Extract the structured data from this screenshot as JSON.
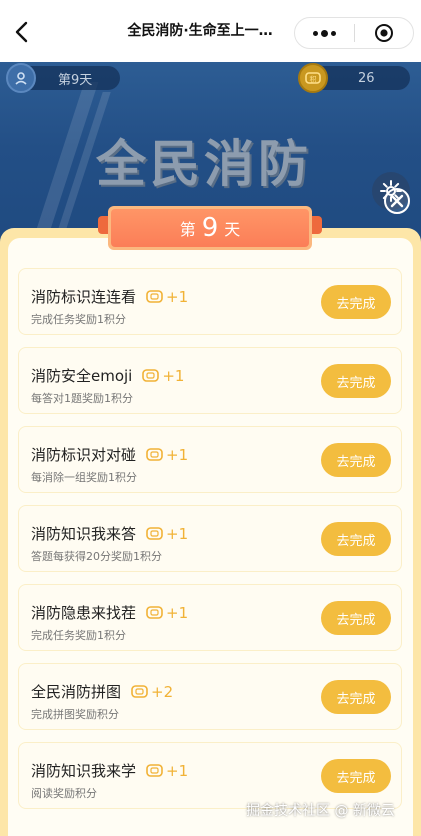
{
  "nav": {
    "title": "全民消防·生命至上一…"
  },
  "banner": {
    "title": "全民消防",
    "day_pill": "第9天",
    "points_pill": "26"
  },
  "panel": {
    "day_prefix": "第",
    "day_number": "9",
    "day_suffix": "天"
  },
  "tasks": [
    {
      "name": "消防标识连连看",
      "reward": "+1",
      "desc": "完成任务奖励1积分",
      "button": "去完成"
    },
    {
      "name": "消防安全emoji",
      "reward": "+1",
      "desc": "每答对1题奖励1积分",
      "button": "去完成"
    },
    {
      "name": "消防标识对对碰",
      "reward": "+1",
      "desc": "每消除一组奖励1积分",
      "button": "去完成"
    },
    {
      "name": "消防知识我来答",
      "reward": "+1",
      "desc": "答题每获得20分奖励1积分",
      "button": "去完成"
    },
    {
      "name": "消防隐患来找茬",
      "reward": "+1",
      "desc": "完成任务奖励1积分",
      "button": "去完成"
    },
    {
      "name": "全民消防拼图",
      "reward": "+2",
      "desc": "完成拼图奖励积分",
      "button": "去完成"
    },
    {
      "name": "消防知识我来学",
      "reward": "+1",
      "desc": "阅读奖励积分",
      "button": "去完成"
    }
  ],
  "watermark": "掘金技术社区 @ 新微云",
  "icons": {
    "back": "back-arrow-icon",
    "more": "more-dots-icon",
    "close_mini": "target-circle-icon",
    "day": "location-pin-icon",
    "points": "coin-icon",
    "settings": "gear-icon",
    "close": "close-icon"
  },
  "colors": {
    "accent_orange": "#fb7e58",
    "button_yellow": "#f3bd3f",
    "reward_yellow": "#f1b236",
    "panel_bg": "#fde6a8",
    "banner_blue": "#234f86"
  }
}
